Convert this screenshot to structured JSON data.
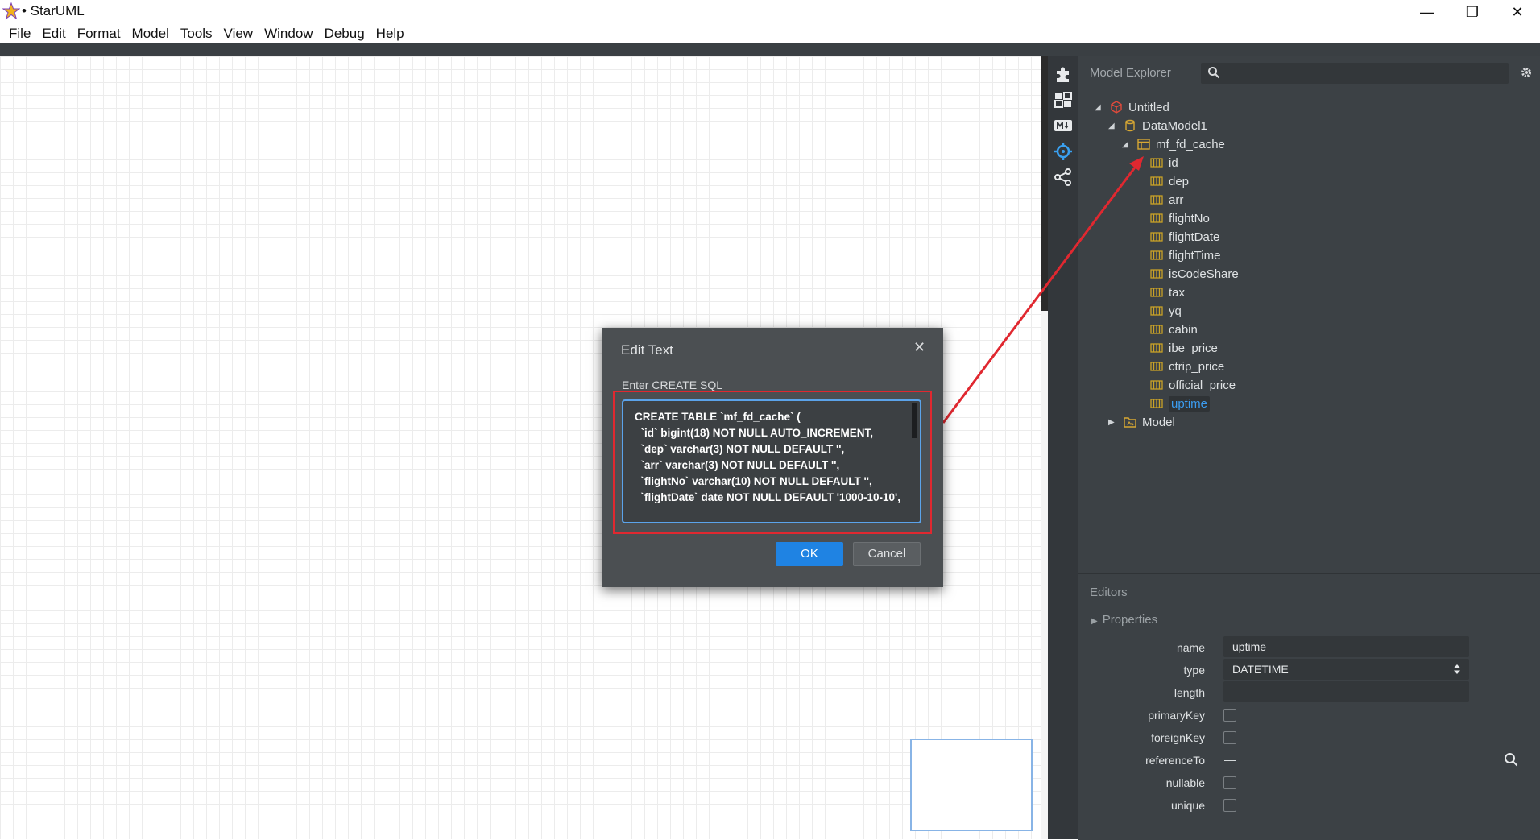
{
  "window": {
    "title": "• StarUML",
    "minimize_glyph": "—",
    "maximize_glyph": "❐",
    "close_glyph": "✕"
  },
  "menu": [
    "File",
    "Edit",
    "Format",
    "Model",
    "Tools",
    "View",
    "Window",
    "Debug",
    "Help"
  ],
  "explorer": {
    "title": "Model Explorer",
    "tree": [
      {
        "label": "Untitled",
        "icon": "project-icon",
        "expanded": true
      },
      {
        "label": "DataModel1",
        "icon": "datamodel-icon",
        "expanded": true
      },
      {
        "label": "mf_fd_cache",
        "icon": "table-icon",
        "expanded": true
      },
      {
        "label": "id",
        "icon": "column-icon"
      },
      {
        "label": "dep",
        "icon": "column-icon"
      },
      {
        "label": "arr",
        "icon": "column-icon"
      },
      {
        "label": "flightNo",
        "icon": "column-icon"
      },
      {
        "label": "flightDate",
        "icon": "column-icon"
      },
      {
        "label": "flightTime",
        "icon": "column-icon"
      },
      {
        "label": "isCodeShare",
        "icon": "column-icon"
      },
      {
        "label": "tax",
        "icon": "column-icon"
      },
      {
        "label": "yq",
        "icon": "column-icon"
      },
      {
        "label": "cabin",
        "icon": "column-icon"
      },
      {
        "label": "ibe_price",
        "icon": "column-icon"
      },
      {
        "label": "ctrip_price",
        "icon": "column-icon"
      },
      {
        "label": "official_price",
        "icon": "column-icon"
      },
      {
        "label": "uptime",
        "icon": "column-icon",
        "selected": true
      },
      {
        "label": "Model",
        "icon": "model-icon",
        "expanded": false
      }
    ]
  },
  "editors": {
    "title": "Editors",
    "section": "Properties",
    "properties": [
      {
        "label": "name",
        "kind": "text",
        "value": "uptime"
      },
      {
        "label": "type",
        "kind": "select",
        "value": "DATETIME"
      },
      {
        "label": "length",
        "kind": "text",
        "value": "—"
      },
      {
        "label": "primaryKey",
        "kind": "checkbox",
        "checked": false
      },
      {
        "label": "foreignKey",
        "kind": "checkbox",
        "checked": false
      },
      {
        "label": "referenceTo",
        "kind": "ref",
        "value": "—"
      },
      {
        "label": "nullable",
        "kind": "checkbox",
        "checked": false
      },
      {
        "label": "unique",
        "kind": "checkbox",
        "checked": false
      }
    ]
  },
  "dialog": {
    "title": "Edit Text",
    "close_glyph": "✕",
    "prompt": "Enter CREATE SQL",
    "sql": "CREATE TABLE `mf_fd_cache` (\n  `id` bigint(18) NOT NULL AUTO_INCREMENT,\n  `dep` varchar(3) NOT NULL DEFAULT '',\n  `arr` varchar(3) NOT NULL DEFAULT '',\n  `flightNo` varchar(10) NOT NULL DEFAULT '',\n  `flightDate` date NOT NULL DEFAULT '1000-10-10',",
    "ok_label": "OK",
    "cancel_label": "Cancel"
  },
  "colors": {
    "annotation_red": "#e02830",
    "accent_blue": "#1f83e3",
    "selection_blue": "#3b9cf0",
    "column_icon": "#c9a227"
  }
}
